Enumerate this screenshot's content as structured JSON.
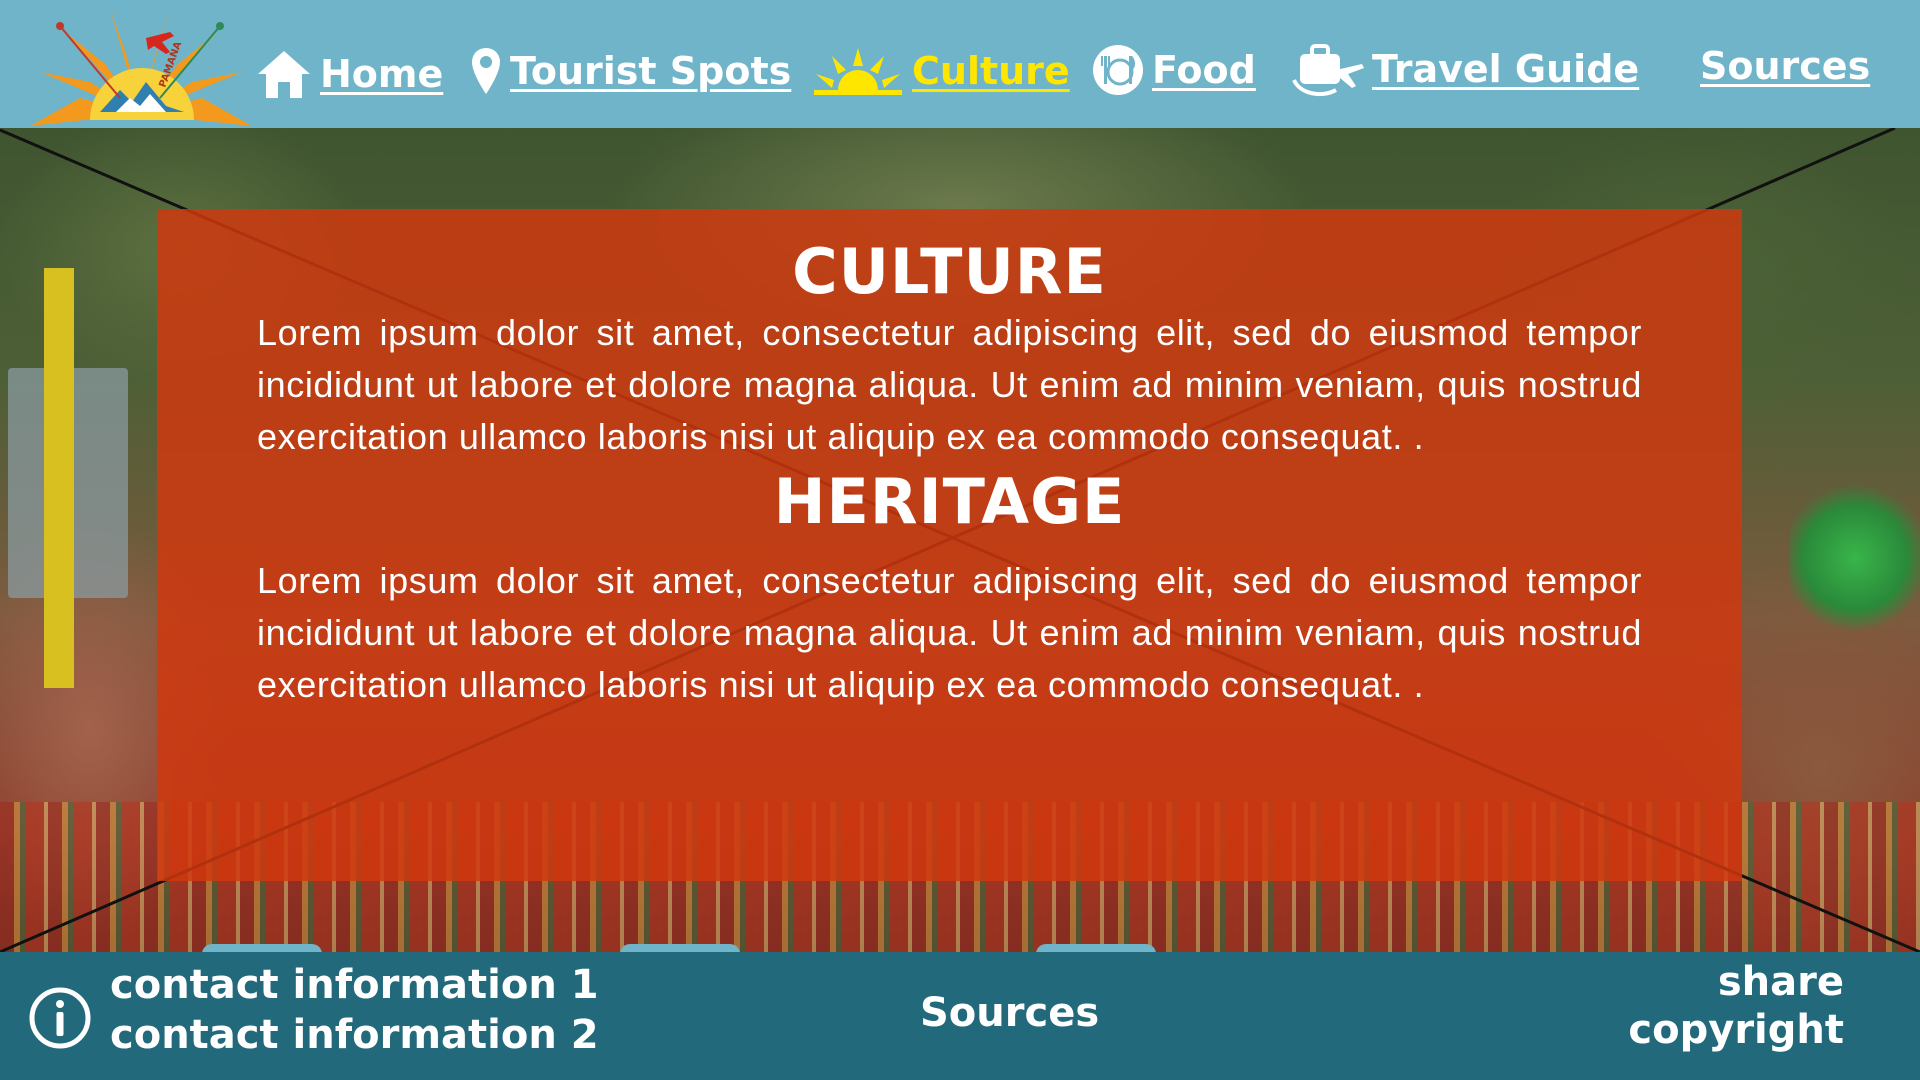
{
  "brand": {
    "logo_text": "PAMANA ADVENTURES",
    "colors": {
      "header": "#6fb4c8",
      "footer": "#23697c",
      "panel": "#d0380e",
      "active": "#ffe600"
    }
  },
  "nav": {
    "items": [
      {
        "label": "Home",
        "icon": "home-icon",
        "active": false
      },
      {
        "label": "Tourist Spots ",
        "icon": "location-pin-icon",
        "active": false
      },
      {
        "label": "Culture",
        "icon": "sun-icon",
        "active": true
      },
      {
        "label": "Food",
        "icon": "plate-cutlery-icon",
        "active": false
      },
      {
        "label": "Travel Guide",
        "icon": "luggage-plane-icon",
        "active": false
      },
      {
        "label": "Sources",
        "icon": "",
        "active": false
      }
    ]
  },
  "main": {
    "culture": {
      "heading": "CULTURE",
      "body": "Lorem ipsum dolor sit amet, consectetur adipiscing elit, sed do eiusmod tempor incididunt ut labore et dolore magna aliqua. Ut enim ad minim veniam, quis nostrud exercitation ullamco laboris nisi ut aliquip ex ea commodo consequat. ."
    },
    "heritage": {
      "heading": "HERITAGE",
      "body": "Lorem ipsum dolor sit amet, consectetur adipiscing elit, sed do eiusmod tempor incididunt ut labore et dolore magna aliqua. Ut enim ad minim veniam, quis nostrud exercitation ullamco laboris nisi ut aliquip ex ea commodo consequat. ."
    }
  },
  "footer": {
    "contact_1": "contact information 1",
    "contact_2": "contact information 2",
    "sources": "Sources",
    "share": "share",
    "copyright": "copyright",
    "info_icon": "info-icon"
  }
}
